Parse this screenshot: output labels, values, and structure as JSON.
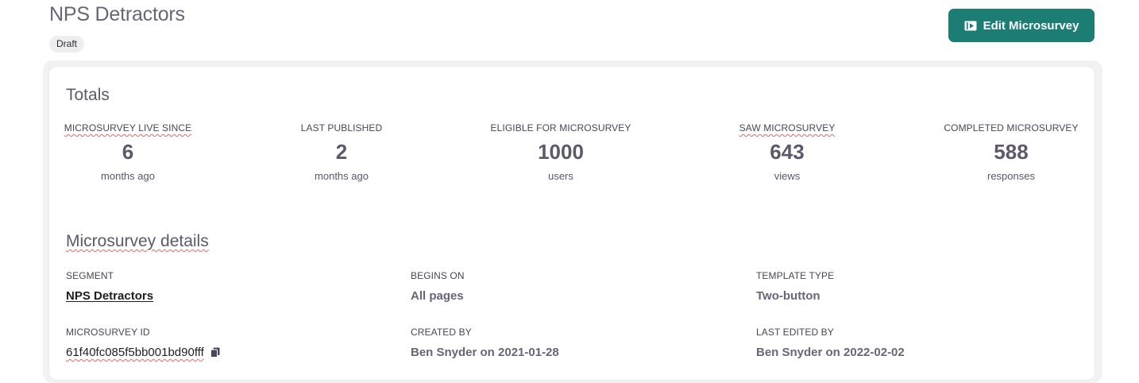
{
  "header": {
    "title": "NPS Detractors",
    "status_badge": "Draft",
    "edit_button_label": "Edit Microsurvey",
    "edit_button_icon": "play-square-icon",
    "accent_color": "#1c7d74"
  },
  "totals": {
    "heading": "Totals",
    "stats": [
      {
        "label": "MICROSURVEY LIVE SINCE",
        "value": "6",
        "unit": "months ago"
      },
      {
        "label": "LAST PUBLISHED",
        "value": "2",
        "unit": "months ago"
      },
      {
        "label": "ELIGIBLE FOR MICROSURVEY",
        "value": "1000",
        "unit": "users"
      },
      {
        "label": "SAW MICROSURVEY",
        "value": "643",
        "unit": "views"
      },
      {
        "label": "COMPLETED MICROSURVEY",
        "value": "588",
        "unit": "responses"
      }
    ]
  },
  "details": {
    "heading": "Microsurvey details",
    "segment": {
      "label": "SEGMENT",
      "value": "NPS Detractors"
    },
    "begins_on": {
      "label": "BEGINS ON",
      "value": "All pages"
    },
    "template_type": {
      "label": "TEMPLATE TYPE",
      "value": "Two-button"
    },
    "microsurvey_id": {
      "label": "MICROSURVEY ID",
      "value": "61f40fc085f5bb001bd90fff",
      "icon": "copy-icon"
    },
    "created_by": {
      "label": "CREATED BY",
      "value": "Ben Snyder on 2021-01-28"
    },
    "last_edited_by": {
      "label": "LAST EDITED BY",
      "value": "Ben Snyder on 2022-02-02"
    }
  }
}
